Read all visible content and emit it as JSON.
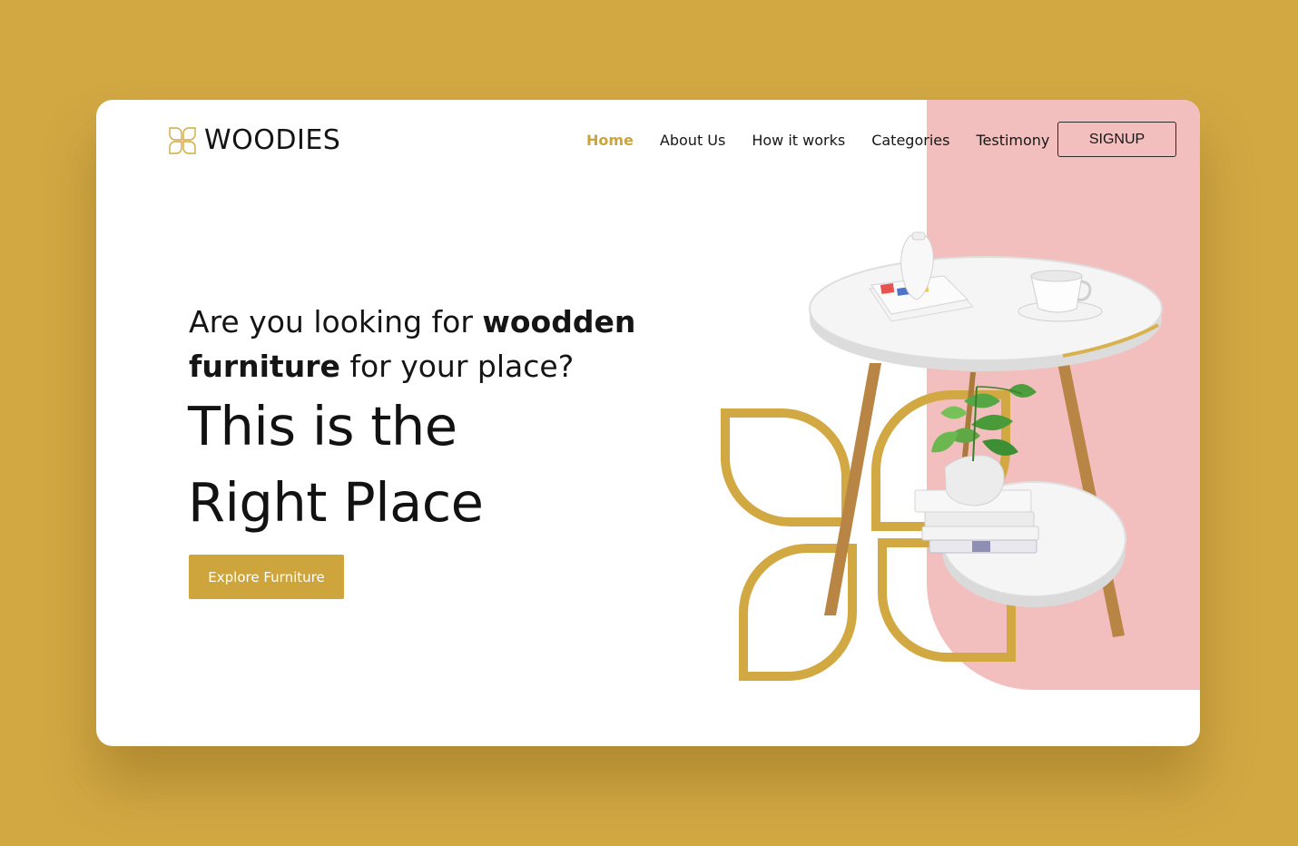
{
  "brand": {
    "name": "WOODIES",
    "logo_icon": "flower-petals-icon",
    "accent_color": "#D2A843",
    "panel_color": "#F2BFBE"
  },
  "nav": {
    "items": [
      {
        "label": "Home",
        "active": true
      },
      {
        "label": "About Us",
        "active": false
      },
      {
        "label": "How it works",
        "active": false
      },
      {
        "label": "Categories",
        "active": false
      },
      {
        "label": "Testimony",
        "active": false
      }
    ],
    "signup_label": "SIGNUP"
  },
  "hero": {
    "question_part1": "Are you looking for ",
    "question_bold": "woodden furniture",
    "question_part2": " for your place?",
    "title_line1": "This is the",
    "title_line2": "Right Place",
    "cta_label": "Explore Furniture",
    "image": "side-table-with-plant-books-cup-and-vase"
  }
}
